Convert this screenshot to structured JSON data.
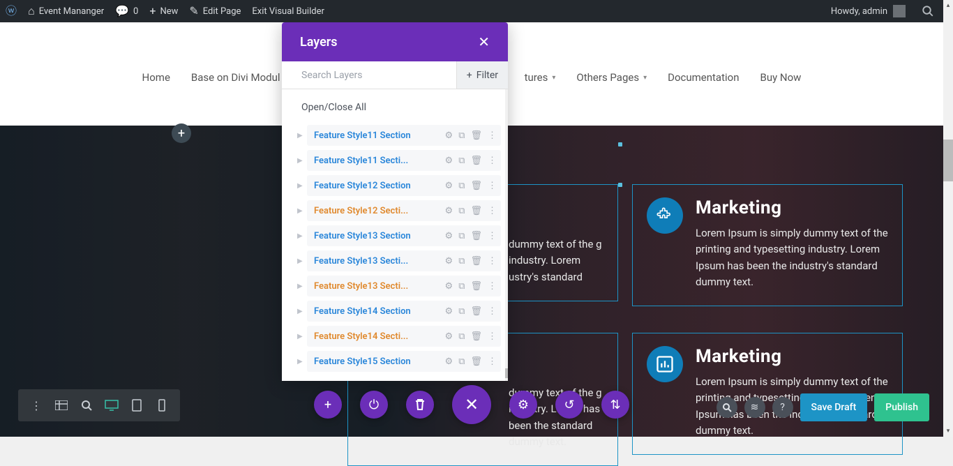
{
  "admin_bar": {
    "site_name": "Event Mananger",
    "comments_count": "0",
    "new_label": "New",
    "edit_page": "Edit Page",
    "exit_builder": "Exit Visual Builder",
    "howdy": "Howdy, admin"
  },
  "nav": {
    "items": [
      {
        "label": "Home",
        "caret": false
      },
      {
        "label": "Base on Divi Modul",
        "caret": false
      },
      {
        "label": "tures",
        "caret": true
      },
      {
        "label": "Others Pages",
        "caret": true
      },
      {
        "label": "Documentation",
        "caret": false
      },
      {
        "label": "Buy Now",
        "caret": false
      }
    ]
  },
  "layers_panel": {
    "title": "Layers",
    "search_placeholder": "Search Layers",
    "filter_label": "Filter",
    "open_close_all": "Open/Close All",
    "items": [
      {
        "name": "Feature Style11 Section",
        "orange": false
      },
      {
        "name": "Feature Style11 Secti...",
        "orange": false
      },
      {
        "name": "Feature Style12 Section",
        "orange": false
      },
      {
        "name": "Feature Style12 Secti...",
        "orange": true
      },
      {
        "name": "Feature Style13 Section",
        "orange": false
      },
      {
        "name": "Feature Style13 Secti...",
        "orange": false
      },
      {
        "name": "Feature Style13 Secti...",
        "orange": true
      },
      {
        "name": "Feature Style14 Section",
        "orange": false
      },
      {
        "name": "Feature Style14 Secti...",
        "orange": true
      },
      {
        "name": "Feature Style15 Section",
        "orange": false
      }
    ]
  },
  "cards": {
    "c1": {
      "title": "",
      "text": "dummy text of the g industry. Lorem ustry's standard"
    },
    "c2": {
      "title": "Marketing",
      "text": "Lorem Ipsum is simply dummy text of the printing and typesetting industry. Lorem Ipsum has been the industry's standard dummy text."
    },
    "c3": {
      "title": "",
      "text": "dummy text of the g industry. Lorem has been the standard dummy text."
    },
    "c4": {
      "title": "Marketing",
      "text": "Lorem Ipsum is simply dummy text of the printing and typesetting industry. Lorem Ipsum has been the industry's standard dummy text."
    }
  },
  "bottom": {
    "save_draft": "Save Draft",
    "publish": "Publish"
  }
}
